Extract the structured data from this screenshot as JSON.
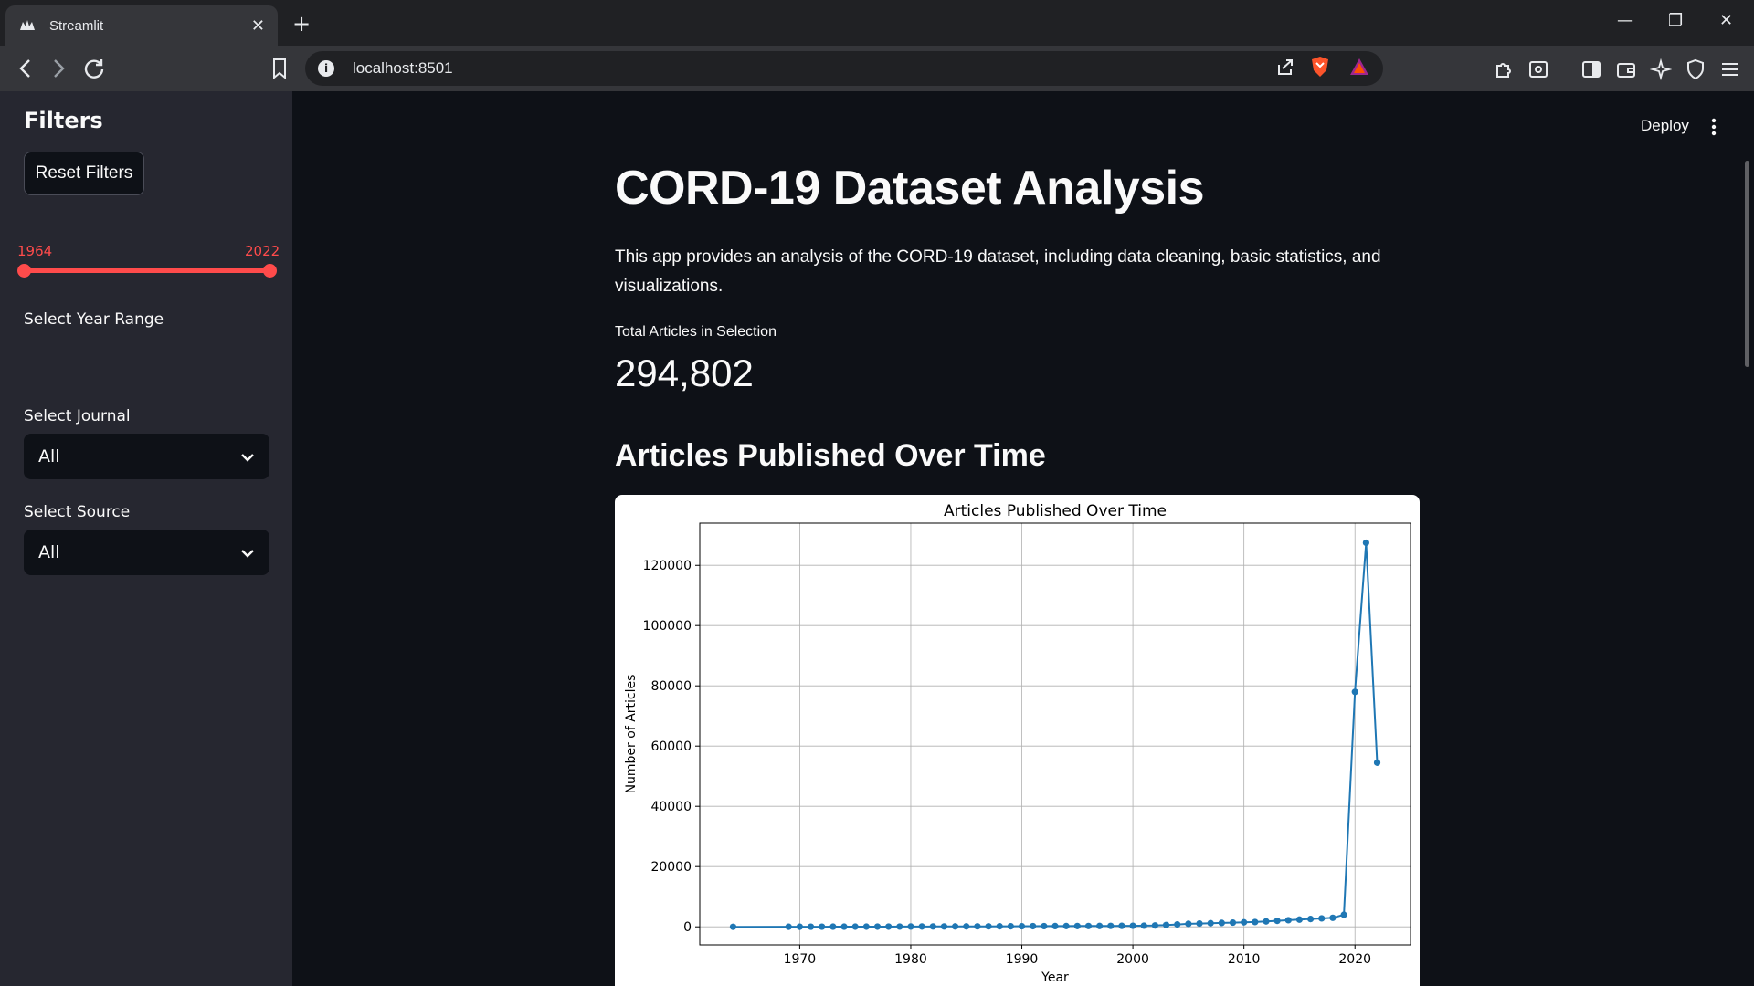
{
  "browser": {
    "tab_title": "Streamlit",
    "url": "localhost:8501"
  },
  "sidebar": {
    "title": "Filters",
    "reset_button": "Reset Filters",
    "year_range": {
      "label": "Select Year Range",
      "min_label": "1964",
      "max_label": "2022",
      "min": 1964,
      "max": 2022,
      "selected_low": 1964,
      "selected_high": 2022
    },
    "journal": {
      "label": "Select Journal",
      "value": "All"
    },
    "source": {
      "label": "Select Source",
      "value": "All"
    }
  },
  "header": {
    "deploy_label": "Deploy"
  },
  "main": {
    "title": "CORD-19 Dataset Analysis",
    "description": "This app provides an analysis of the CORD-19 dataset, including data cleaning, basic statistics, and visualizations.",
    "metric": {
      "label": "Total Articles in Selection",
      "value": "294,802"
    },
    "section_title": "Articles Published Over Time"
  },
  "colors": {
    "accent": "#ff4b4b",
    "series": "#1f77b4",
    "background": "#0e1117",
    "sidebar": "#262730"
  },
  "chart_data": {
    "type": "line",
    "title": "Articles Published Over Time",
    "xlabel": "Year",
    "ylabel": "Number of Articles",
    "xlim": [
      1961,
      2025
    ],
    "ylim": [
      -6000,
      134000
    ],
    "xticks": [
      1970,
      1980,
      1990,
      2000,
      2010,
      2020
    ],
    "yticks": [
      0,
      20000,
      40000,
      60000,
      80000,
      100000,
      120000
    ],
    "grid": true,
    "x": [
      1964,
      1969,
      1970,
      1971,
      1972,
      1973,
      1974,
      1975,
      1976,
      1977,
      1978,
      1979,
      1980,
      1981,
      1982,
      1983,
      1984,
      1985,
      1986,
      1987,
      1988,
      1989,
      1990,
      1991,
      1992,
      1993,
      1994,
      1995,
      1996,
      1997,
      1998,
      1999,
      2000,
      2001,
      2002,
      2003,
      2004,
      2005,
      2006,
      2007,
      2008,
      2009,
      2010,
      2011,
      2012,
      2013,
      2014,
      2015,
      2016,
      2017,
      2018,
      2019,
      2020,
      2021,
      2022
    ],
    "y": [
      10,
      20,
      30,
      40,
      40,
      50,
      50,
      60,
      60,
      70,
      70,
      80,
      90,
      100,
      110,
      120,
      130,
      140,
      150,
      160,
      170,
      180,
      200,
      220,
      230,
      240,
      250,
      260,
      270,
      280,
      300,
      320,
      340,
      380,
      450,
      600,
      800,
      1000,
      1100,
      1200,
      1300,
      1400,
      1500,
      1600,
      1800,
      2000,
      2200,
      2400,
      2600,
      2800,
      3000,
      4000,
      78000,
      127500,
      54500
    ]
  }
}
